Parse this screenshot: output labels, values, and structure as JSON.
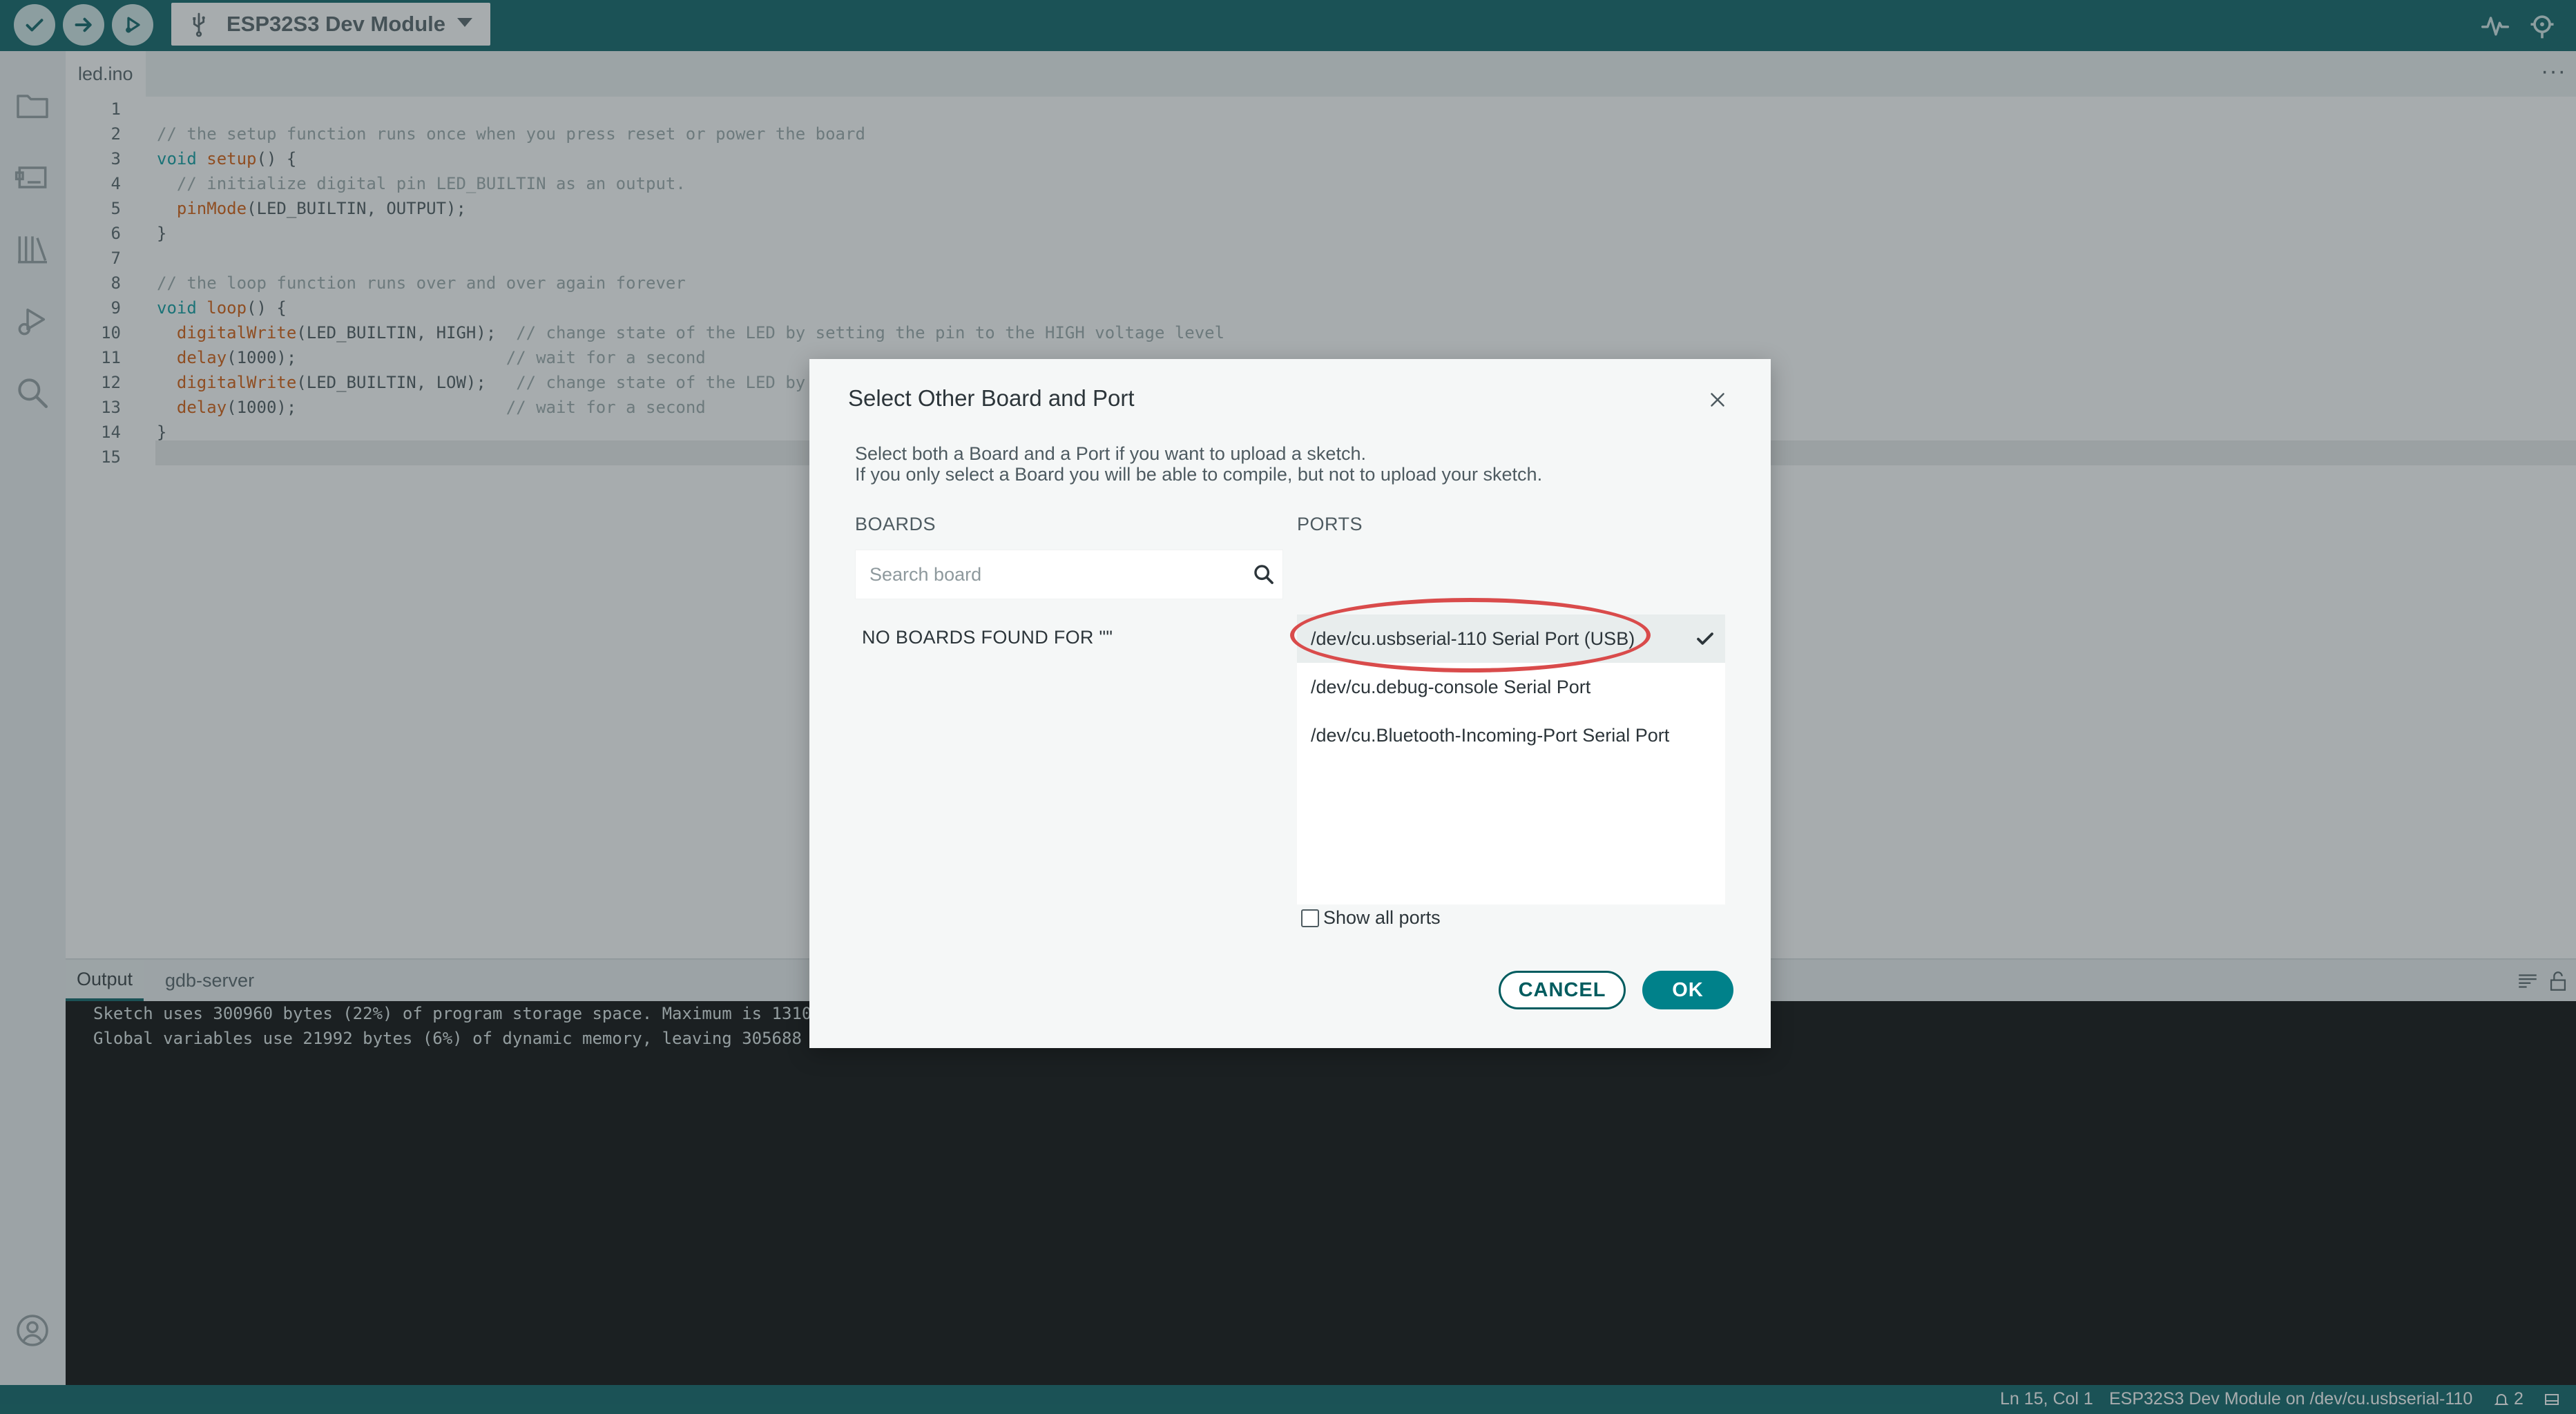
{
  "toolbar": {
    "verify_icon": "check-icon",
    "upload_icon": "arrow-right-icon",
    "debug_icon": "debug-icon",
    "board_name": "ESP32S3 Dev Module",
    "usb_icon": "usb-icon",
    "serial_plotter_icon": "plotter-icon",
    "serial_monitor_icon": "serial-monitor-icon"
  },
  "sidebar": {
    "items": [
      {
        "icon": "folder-icon"
      },
      {
        "icon": "board-manager-icon"
      },
      {
        "icon": "library-icon"
      },
      {
        "icon": "debug-icon"
      },
      {
        "icon": "search-icon"
      },
      {
        "icon": "account-icon"
      }
    ]
  },
  "editor": {
    "tab_label": "led.ino",
    "more_label": "···",
    "line_numbers": [
      "1",
      "2",
      "3",
      "4",
      "5",
      "6",
      "7",
      "8",
      "9",
      "10",
      "11",
      "12",
      "13",
      "14",
      "15"
    ],
    "lines": {
      "l2": "// the setup function runs once when you press reset or power the board",
      "l3_kw": "void",
      "l3_fn": "setup",
      "l3_rest": "() {",
      "l4": "  // initialize digital pin LED_BUILTIN as an output.",
      "l5_fn": "pinMode",
      "l5_rest": "(LED_BUILTIN, OUTPUT);",
      "l6": "}",
      "l8": "// the loop function runs over and over again forever",
      "l9_kw": "void",
      "l9_fn": "loop",
      "l9_rest": "() {",
      "l10_fn": "digitalWrite",
      "l10_rest": "(LED_BUILTIN, HIGH);",
      "l10_com": "// change state of the LED by setting the pin to the HIGH voltage level",
      "l11_fn": "delay",
      "l11_rest": "(1000);",
      "l11_com": "// wait for a second",
      "l12_fn": "digitalWrite",
      "l12_rest": "(LED_BUILTIN, LOW);",
      "l12_com": "// change state of the LED by",
      "l13_fn": "delay",
      "l13_rest": "(1000);",
      "l13_com": "// wait for a second",
      "l14": "}"
    }
  },
  "panel": {
    "tabs": [
      "Output",
      "gdb-server"
    ],
    "output_lines": [
      "Sketch uses 300960 bytes (22%) of program storage space. Maximum is 1310",
      "Global variables use 21992 bytes (6%) of dynamic memory, leaving 305688"
    ]
  },
  "statusbar": {
    "position": "Ln 15, Col 1",
    "board_port": "ESP32S3 Dev Module on /dev/cu.usbserial-110",
    "notifications": "2"
  },
  "dialog": {
    "title": "Select Other Board and Port",
    "description_line1": "Select both a Board and a Port if you want to upload a sketch.",
    "description_line2": "If you only select a Board you will be able to compile, but not to upload your sketch.",
    "boards_header": "BOARDS",
    "ports_header": "PORTS",
    "search_placeholder": "Search board",
    "search_value": "",
    "no_boards": "NO BOARDS FOUND FOR \"\"",
    "ports": [
      {
        "label": "/dev/cu.usbserial-110 Serial Port (USB)",
        "selected": true
      },
      {
        "label": "/dev/cu.debug-console Serial Port",
        "selected": false
      },
      {
        "label": "/dev/cu.Bluetooth-Incoming-Port Serial Port",
        "selected": false
      }
    ],
    "show_all_ports_label": "Show all ports",
    "show_all_ports_checked": false,
    "cancel_label": "CANCEL",
    "ok_label": "OK"
  },
  "colors": {
    "brand_teal": "#005c5f",
    "ok_button": "#00818a",
    "highlight_ring": "#d94b4b",
    "code_keyword": "#00979c",
    "code_function": "#d35400",
    "code_comment": "#95a5a6"
  }
}
